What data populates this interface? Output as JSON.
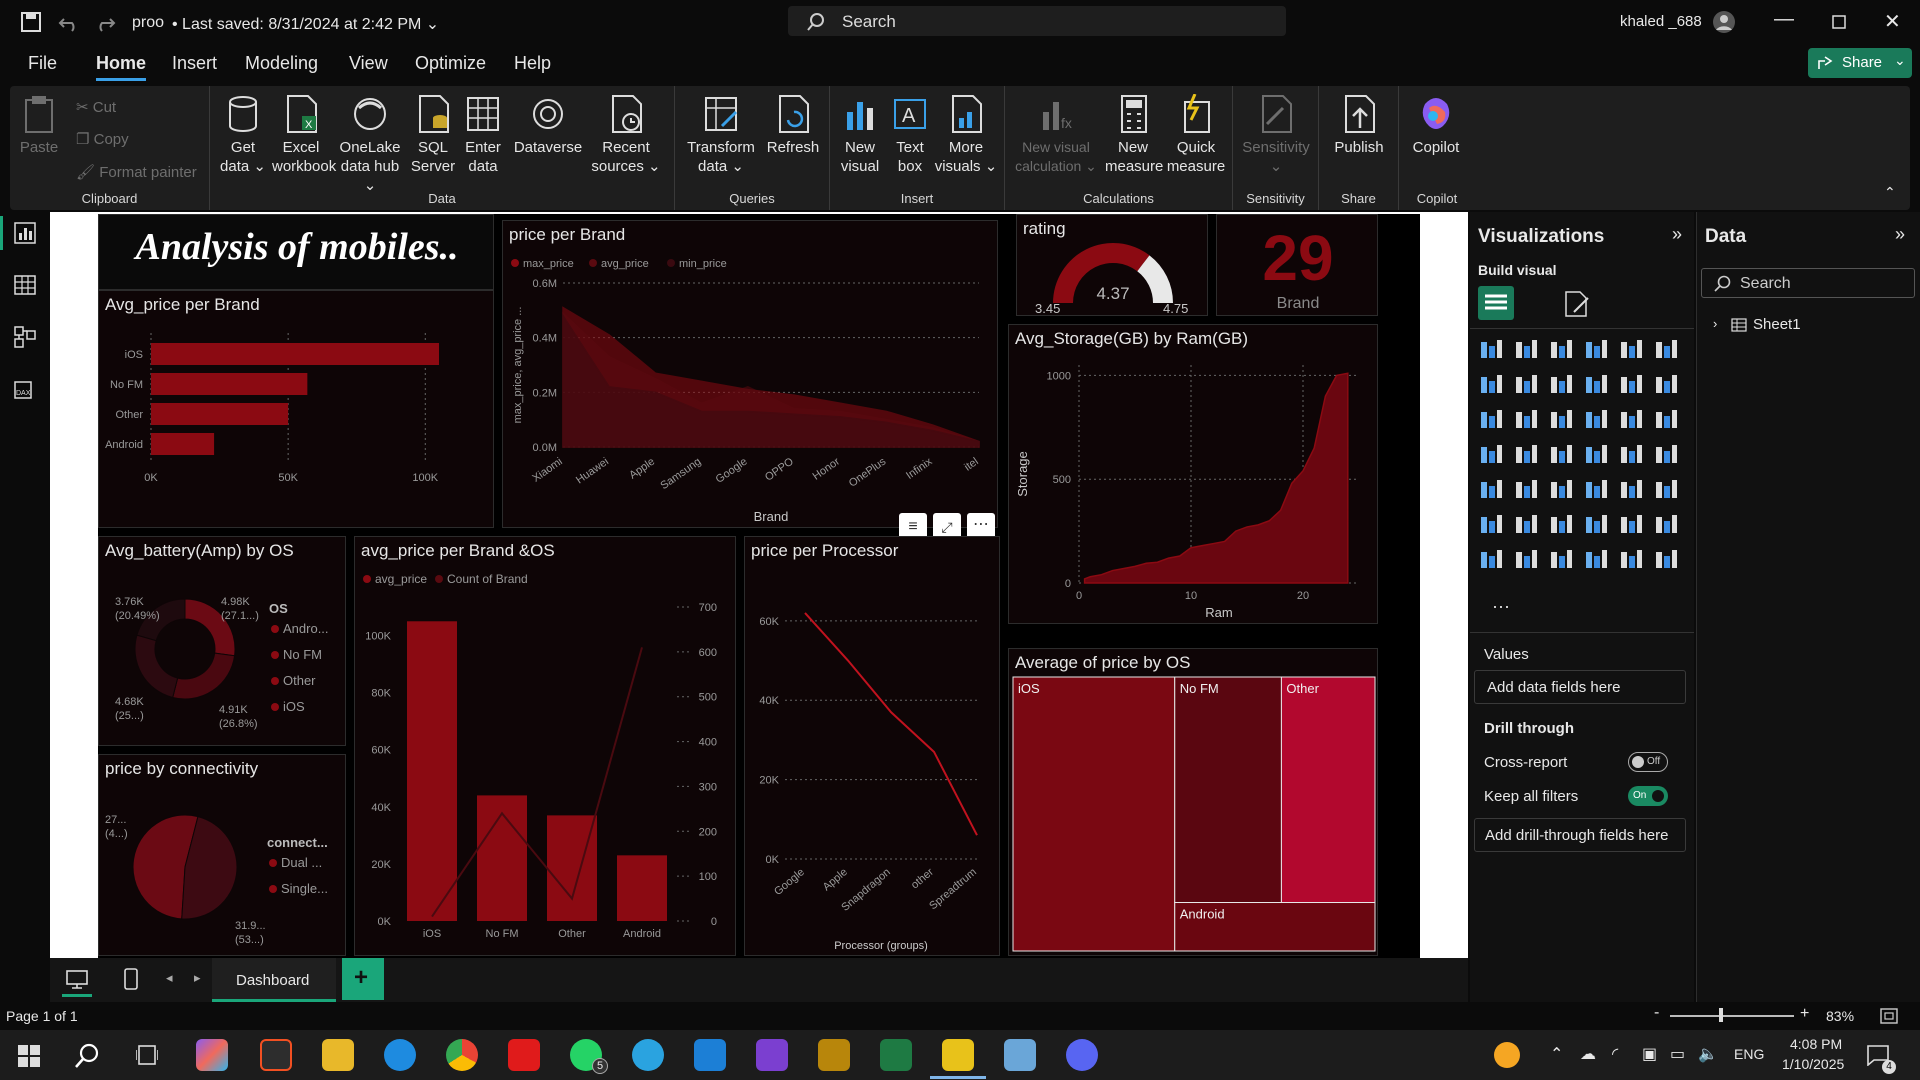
{
  "titlebar": {
    "file_name": "proo",
    "saved_status": "Last saved: 8/31/2024 at 2:42 PM",
    "search_label": "Search",
    "user": "khaled _688"
  },
  "menu": [
    "File",
    "Home",
    "Insert",
    "Modeling",
    "View",
    "Optimize",
    "Help"
  ],
  "share_label": "Share",
  "ribbon": {
    "clipboard": {
      "paste": "Paste",
      "cut": "Cut",
      "copy": "Copy",
      "format_painter": "Format painter",
      "group": "Clipboard"
    },
    "data": {
      "get_data": "Get data",
      "excel": "Excel workbook",
      "onelake": "OneLake data hub",
      "sql": "SQL Server",
      "enter": "Enter data",
      "dataverse": "Dataverse",
      "recent": "Recent sources",
      "group": "Data"
    },
    "queries": {
      "transform": "Transform data",
      "refresh": "Refresh",
      "group": "Queries"
    },
    "insert": {
      "new_visual": "New visual",
      "text_box": "Text box",
      "more_visuals": "More visuals",
      "group": "Insert"
    },
    "calculations": {
      "new_visual_calc": "New visual calculation",
      "new_measure": "New measure",
      "quick_measure": "Quick measure",
      "group": "Calculations"
    },
    "sensitivity": {
      "btn": "Sensitivity",
      "group": "Sensitivity"
    },
    "share": {
      "publish": "Publish",
      "group": "Share"
    },
    "copilot": {
      "btn": "Copilot",
      "group": "Copilot"
    }
  },
  "report": {
    "header_title": "Analysis of mobiles..",
    "kpi_value": "29",
    "kpi_label": "Brand"
  },
  "chart_data": [
    {
      "id": "avg-price-per-brand",
      "type": "bar",
      "title": "Avg_price per Brand",
      "categories": [
        "iOS",
        "No FM",
        "Other",
        "Android"
      ],
      "values": [
        105000,
        57000,
        50000,
        23000
      ],
      "xlim": [
        0,
        105000
      ],
      "xticks": [
        "0K",
        "50K",
        "100K"
      ],
      "color": "#8b0a12"
    },
    {
      "id": "price-per-brand",
      "type": "area",
      "title": "price per Brand",
      "legend": [
        "max_price",
        "avg_price",
        "min_price"
      ],
      "categories": [
        "Xiaomi",
        "Huawei",
        "Apple",
        "Samsung",
        "Google",
        "OPPO",
        "Honor",
        "OnePlus",
        "Infinix",
        "itel"
      ],
      "series": [
        {
          "name": "max_price",
          "values": [
            0.51,
            0.41,
            0.27,
            0.24,
            0.21,
            0.19,
            0.16,
            0.13,
            0.08,
            0.02
          ]
        },
        {
          "name": "avg_price",
          "values": [
            0.49,
            0.33,
            0.25,
            0.16,
            0.22,
            0.14,
            0.13,
            0.1,
            0.07,
            0.02
          ]
        },
        {
          "name": "min_price",
          "values": [
            0.48,
            0.22,
            0.2,
            0.13,
            0.13,
            0.12,
            0.11,
            0.09,
            0.06,
            0.02
          ]
        }
      ],
      "ylim": [
        0,
        0.6
      ],
      "yticks": [
        "0.0M",
        "0.2M",
        "0.4M",
        "0.6M"
      ],
      "xlabel": "Brand",
      "ylabel": "max_price, avg_price ..."
    },
    {
      "id": "rating-gauge",
      "type": "gauge",
      "title": "rating",
      "min": 3.45,
      "max": 4.75,
      "value": 4.37,
      "labels": [
        "3.45",
        "4.37",
        "4.75"
      ]
    },
    {
      "id": "avg-storage-by-ram",
      "type": "area",
      "title": "Avg_Storage(GB) by Ram(GB)",
      "x": [
        0.5,
        1,
        2,
        3,
        4,
        5,
        6,
        7,
        8,
        9,
        10,
        11,
        12,
        13,
        14,
        15,
        16,
        17,
        18,
        19,
        20,
        21,
        22,
        23,
        24
      ],
      "values": [
        20,
        30,
        40,
        60,
        70,
        80,
        95,
        100,
        120,
        130,
        170,
        180,
        190,
        200,
        250,
        270,
        280,
        300,
        350,
        480,
        540,
        650,
        900,
        1000,
        1010
      ],
      "xlim": [
        0,
        25
      ],
      "ylim": [
        0,
        1050
      ],
      "xticks": [
        "0",
        "10",
        "20"
      ],
      "yticks": [
        "0",
        "500",
        "1000"
      ],
      "xlabel": "Ram",
      "ylabel": "Storage"
    },
    {
      "id": "avg-battery-by-os",
      "type": "pie",
      "title": "Avg_battery(Amp) by OS",
      "legend_title": "OS",
      "legend": [
        "Andro...",
        "No FM",
        "Other",
        "iOS"
      ],
      "values": [
        4.98,
        4.91,
        4.68,
        3.76
      ],
      "slice_labels": [
        [
          "4.98K",
          "(27.1...)"
        ],
        [
          "4.91K",
          "(26.8%)"
        ],
        [
          "4.68K",
          "(25...)"
        ],
        [
          "3.76K",
          "(20.49%)"
        ]
      ],
      "colors": [
        "#6b0a14",
        "#4a0810",
        "#2c0a10",
        "#1e0a0e"
      ]
    },
    {
      "id": "avg-price-per-brand-os",
      "type": "bar",
      "title": "avg_price per Brand &OS",
      "legend": [
        "avg_price",
        "Count of Brand"
      ],
      "categories": [
        "iOS",
        "No FM",
        "Other",
        "Android"
      ],
      "values": [
        105000,
        44000,
        37000,
        23000
      ],
      "line_values": [
        10,
        240,
        50,
        610
      ],
      "ylim": [
        0,
        110000
      ],
      "yticks": [
        "0K",
        "20K",
        "40K",
        "60K",
        "80K",
        "100K"
      ],
      "y2lim": [
        0,
        700
      ],
      "y2ticks": [
        "0",
        "100",
        "200",
        "300",
        "400",
        "500",
        "600",
        "700"
      ]
    },
    {
      "id": "price-per-processor",
      "type": "line",
      "title": "price per Processor",
      "categories": [
        "Google",
        "Apple",
        "Snapdragon",
        "other",
        "Spreadtrum"
      ],
      "values": [
        62000,
        50000,
        37000,
        27000,
        6000
      ],
      "ylim": [
        0,
        65000
      ],
      "yticks": [
        "0K",
        "20K",
        "40K",
        "60K"
      ],
      "xlabel": "Processor (groups)"
    },
    {
      "id": "price-by-connectivity",
      "type": "pie",
      "title": "price by connectivity",
      "legend_title": "connect...",
      "legend": [
        "Dual ...",
        "Single..."
      ],
      "values": [
        53,
        47
      ],
      "slice_labels": [
        [
          "31.9...",
          "(53...)"
        ],
        [
          "27...",
          "(4...)"
        ]
      ],
      "colors": [
        "#6b0a14",
        "#3d0a12"
      ]
    },
    {
      "id": "average-price-by-os",
      "type": "treemap",
      "title": "Average of price by OS",
      "categories": [
        "iOS",
        "No FM",
        "Other",
        "Android"
      ],
      "values": [
        105000,
        57000,
        50000,
        23000
      ],
      "colors": [
        "#7a0812",
        "#5a0610",
        "#b2082e",
        "#6a0610"
      ]
    }
  ],
  "visualizations": {
    "title": "Visualizations",
    "build_visual": "Build visual",
    "values_label": "Values",
    "add_data": "Add data fields here",
    "drill_through": "Drill through",
    "cross_report": "Cross-report",
    "cross_report_state": "Off",
    "keep_filters": "Keep all filters",
    "keep_filters_state": "On",
    "add_drill": "Add drill-through fields here"
  },
  "data_pane": {
    "title": "Data",
    "search": "Search",
    "table": "Sheet1"
  },
  "tabs": {
    "page": "Dashboard"
  },
  "status": {
    "page": "Page 1 of 1",
    "zoom": "83%"
  },
  "taskbar": {
    "time": "4:08 PM",
    "date": "1/10/2025",
    "lang": "ENG",
    "whatsapp_badge": "5",
    "notif": "4"
  },
  "colors": {
    "accent": "#1aa67a",
    "bar": "#8b0a12",
    "bg": "#0b0b0b"
  }
}
